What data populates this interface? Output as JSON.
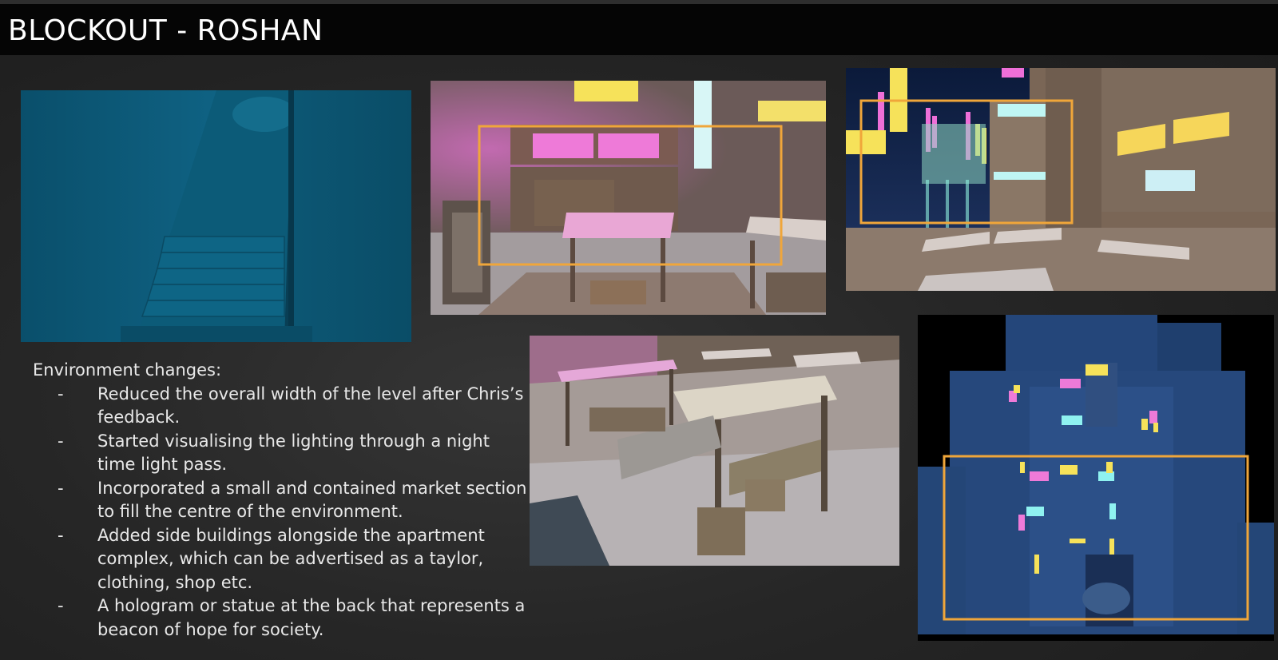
{
  "slide": {
    "title": "BLOCKOUT - ROSHAN"
  },
  "notes": {
    "heading": "Environment changes:",
    "bullet_symbol": "-",
    "items": [
      "Reduced the overall width of the level after Chris’s feedback.",
      "Started visualising the lighting through a night time light pass.",
      "Incorporated a small and contained market section to fill the centre of the environment.",
      "Added side buildings alongside the apartment complex, which can be advertised as a taylor, clothing, shop etc.",
      "A hologram or statue at the back that represents a beacon of hope for society."
    ]
  },
  "images": [
    {
      "name": "staircase-render",
      "description_icon": "image"
    },
    {
      "name": "market-stall-highlighted-render",
      "description_icon": "image"
    },
    {
      "name": "neon-skyline-render",
      "description_icon": "image"
    },
    {
      "name": "market-stalls-closeup-render",
      "description_icon": "image"
    },
    {
      "name": "top-down-layout-render",
      "description_icon": "image"
    }
  ],
  "colors": {
    "highlight_box": "#f0a63a",
    "neon_pink": "#ee6fd8",
    "neon_yellow": "#f6e25a",
    "neon_cyan": "#8ff2f0",
    "title_bar": "#050505"
  }
}
